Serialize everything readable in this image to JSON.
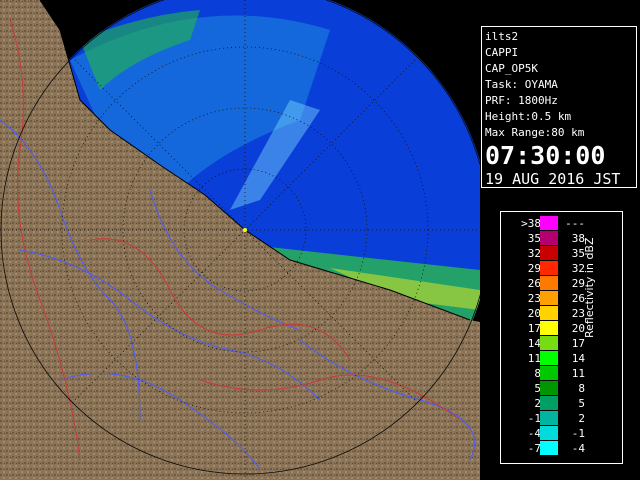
{
  "info": {
    "station": "ilts2",
    "product": "CAPPI",
    "product_code": "CAP_OP5K",
    "task": "Task: OYAMA",
    "prf": "PRF: 1800Hz",
    "height": "Height:0.5 km",
    "max_range": "Max Range:80 km",
    "time": "07:30:00",
    "date": "19 AUG 2016 JST"
  },
  "legend": {
    "title": "Reflectivity in dBZ",
    "rows": [
      {
        "lo": ">38",
        "hi": "---",
        "color": "#ff00ff"
      },
      {
        "lo": "35",
        "hi": "38",
        "color": "#b4006e"
      },
      {
        "lo": "32",
        "hi": "35",
        "color": "#c80000"
      },
      {
        "lo": "29",
        "hi": "32",
        "color": "#ff2800"
      },
      {
        "lo": "26",
        "hi": "29",
        "color": "#ff7800"
      },
      {
        "lo": "23",
        "hi": "26",
        "color": "#ffa000"
      },
      {
        "lo": "20",
        "hi": "23",
        "color": "#ffd200"
      },
      {
        "lo": "17",
        "hi": "20",
        "color": "#ffff00"
      },
      {
        "lo": "14",
        "hi": "17",
        "color": "#78dc14"
      },
      {
        "lo": "11",
        "hi": "14",
        "color": "#00ff00"
      },
      {
        "lo": "8",
        "hi": "11",
        "color": "#00c800"
      },
      {
        "lo": "5",
        "hi": "8",
        "color": "#009600"
      },
      {
        "lo": "2",
        "hi": "5",
        "color": "#00a064"
      },
      {
        "lo": "-1",
        "hi": "2",
        "color": "#00b4a0"
      },
      {
        "lo": "-4",
        "hi": "-1",
        "color": "#00dcdc"
      },
      {
        "lo": "-7",
        "hi": "-4",
        "color": "#00ffff"
      }
    ]
  },
  "colors": {
    "sea": "#0a3ed8",
    "land": "#8a7356",
    "rivers": "#4a5cff",
    "prefecture_lines": "#c83a3a"
  }
}
